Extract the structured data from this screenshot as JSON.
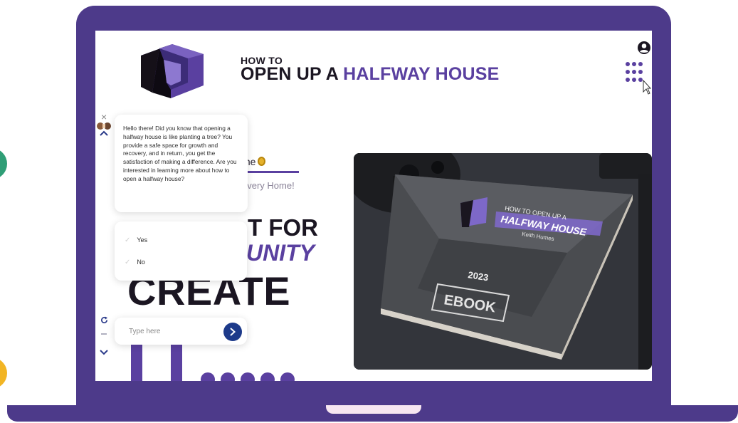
{
  "colors": {
    "laptop_frame": "#4d3a8a",
    "brand_accent": "#5a40a0",
    "chat_send": "#1d3a8a",
    "side_dot_green": "#2f9e76",
    "side_dot_yellow": "#f2b524"
  },
  "header": {
    "brand_small": "HOW TO",
    "brand_big_prefix": "OPEN UP A ",
    "brand_big_accent": "HALFWAY HOUSE",
    "icons": [
      "logo",
      "user-icon",
      "apps-grid-icon",
      "cursor-icon"
    ]
  },
  "page": {
    "tab_fragment": "me",
    "tab_fragment2": "overy Home!",
    "hero_line1": "T FOR",
    "hero_line2": "UNITY",
    "hero_line3": "CREATE"
  },
  "product": {
    "cover_title_top": "HOW TO OPEN UP A",
    "cover_title_main": "HALFWAY HOUSE",
    "cover_author": "Keith Humes",
    "cover_year": "2023",
    "cover_label": "EBOOK"
  },
  "chat": {
    "message": "Hello there! Did you know that opening a halfway house is like planting a tree? You provide a safe space for growth and recovery, and in return, you get the satisfaction of making a difference. Are you interested in learning more about how to open a halfway house?",
    "options": [
      "Yes",
      "No"
    ],
    "input_placeholder": "Type here",
    "close_symbol": "×"
  }
}
